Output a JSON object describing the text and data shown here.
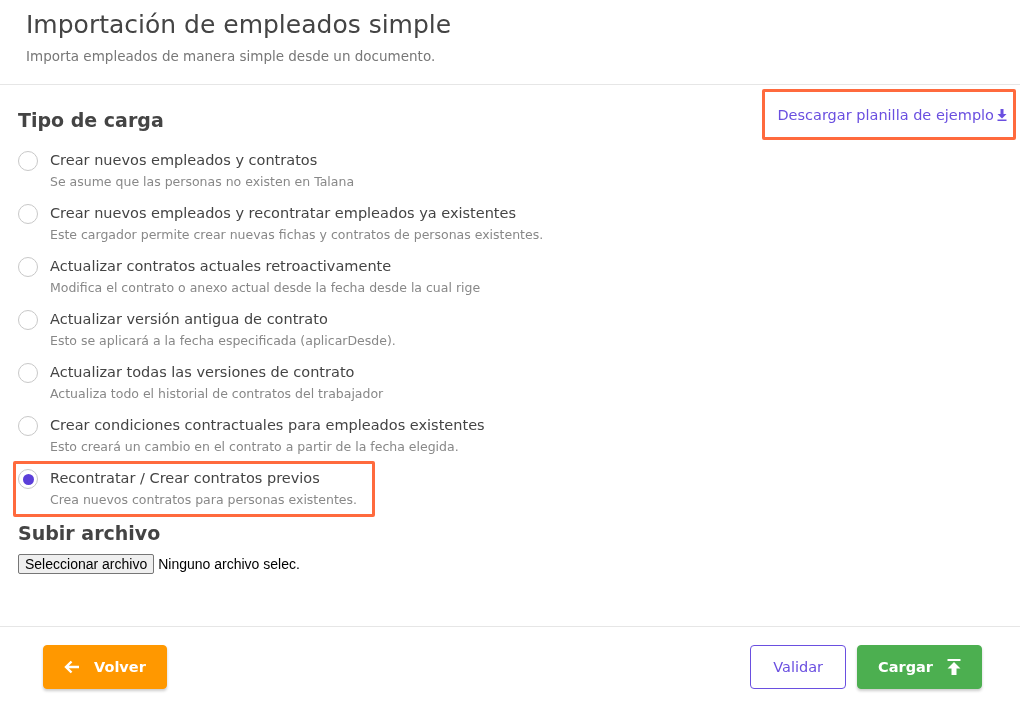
{
  "header": {
    "title": "Importación de empleados simple",
    "subtitle": "Importa empleados de manera simple desde un documento."
  },
  "load_type": {
    "heading": "Tipo de carga",
    "download_link": {
      "label": "Descargar planilla de ejemplo",
      "highlighted": true
    },
    "options": [
      {
        "label": "Crear nuevos empleados y contratos",
        "description": "Se asume que las personas no existen en Talana",
        "selected": false,
        "highlighted": false
      },
      {
        "label": "Crear nuevos empleados y recontratar empleados ya existentes",
        "description": "Este cargador permite crear nuevas fichas y contratos de personas existentes.",
        "selected": false,
        "highlighted": false
      },
      {
        "label": "Actualizar contratos actuales retroactivamente",
        "description": "Modifica el contrato o anexo actual desde la fecha desde la cual rige",
        "selected": false,
        "highlighted": false
      },
      {
        "label": "Actualizar versión antigua de contrato",
        "description": "Esto se aplicará a la fecha especificada (aplicarDesde).",
        "selected": false,
        "highlighted": false
      },
      {
        "label": "Actualizar todas las versiones de contrato",
        "description": "Actualiza todo el historial de contratos del trabajador",
        "selected": false,
        "highlighted": false
      },
      {
        "label": "Crear condiciones contractuales para empleados existentes",
        "description": "Esto creará un cambio en el contrato a partir de la fecha elegida.",
        "selected": false,
        "highlighted": false
      },
      {
        "label": "Recontratar / Crear contratos previos",
        "description": "Crea nuevos contratos para personas existentes.",
        "selected": true,
        "highlighted": true
      }
    ]
  },
  "upload": {
    "heading": "Subir archivo",
    "button": "Seleccionar archivo",
    "file_status": "Ninguno archivo selec."
  },
  "footer": {
    "back_button": "Volver",
    "validate_button": "Validar",
    "upload_button": "Cargar"
  }
}
